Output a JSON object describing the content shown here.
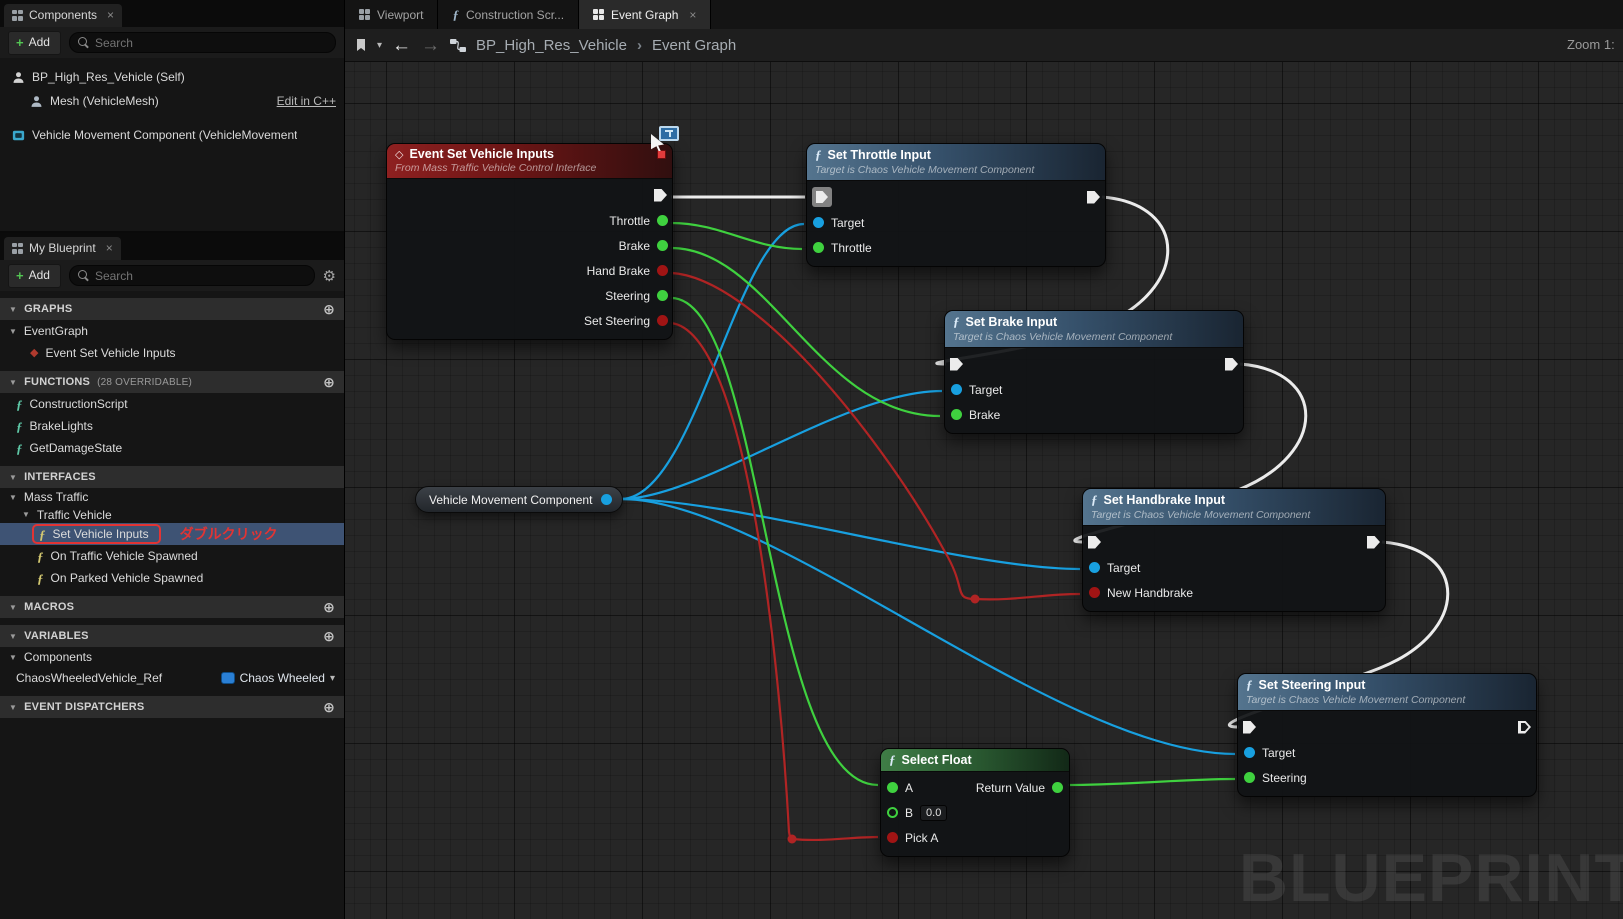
{
  "components_panel": {
    "tab_label": "Components",
    "add_label": "Add",
    "search_placeholder": "Search",
    "rows": [
      {
        "label": "BP_High_Res_Vehicle (Self)"
      },
      {
        "label": "Mesh (VehicleMesh)",
        "link_label": "Edit in C++"
      },
      {
        "label": "Vehicle Movement Component (VehicleMovement"
      }
    ]
  },
  "my_blueprint_panel": {
    "tab_label": "My Blueprint",
    "add_label": "Add",
    "search_placeholder": "Search",
    "graphs": {
      "header": "GRAPHS",
      "eventgraph_label": "EventGraph",
      "event_label": "Event Set Vehicle Inputs"
    },
    "functions": {
      "header": "FUNCTIONS",
      "badge": "(28 OVERRIDABLE)",
      "items": [
        "ConstructionScript",
        "BrakeLights",
        "GetDamageState"
      ]
    },
    "interfaces": {
      "header": "INTERFACES",
      "group": "Mass Traffic",
      "subgroup": "Traffic Vehicle",
      "items": [
        "Set Vehicle Inputs",
        "On Traffic Vehicle Spawned",
        "On Parked Vehicle Spawned"
      ]
    },
    "annotation_label": "ダブルクリック",
    "macros_header": "MACROS",
    "variables": {
      "header": "VARIABLES",
      "category": "Components",
      "var_name": "ChaosWheeledVehicle_Ref",
      "var_type": "Chaos Wheeled"
    },
    "event_dispatchers_header": "EVENT DISPATCHERS"
  },
  "editor_tabs": {
    "viewport": "Viewport",
    "construction": "Construction Scr...",
    "event_graph": "Event Graph"
  },
  "breadcrumb": {
    "root": "BP_High_Res_Vehicle",
    "current": "Event Graph"
  },
  "zoom_label": "Zoom 1:",
  "watermark": "BLUEPRINT",
  "graph": {
    "colors": {
      "exec": "#ececec",
      "float": "#3fd13f",
      "bool": "#a01414",
      "object": "#18a0e0"
    },
    "nodes": {
      "event": {
        "title": "Event Set Vehicle Inputs",
        "subtitle": "From Mass Traffic Vehicle Control Interface",
        "pins": {
          "throttle": "Throttle",
          "brake": "Brake",
          "hand_brake": "Hand Brake",
          "steering": "Steering",
          "set_steering": "Set Steering"
        }
      },
      "set_throttle": {
        "title": "Set Throttle Input",
        "subtitle": "Target is Chaos Vehicle Movement Component",
        "pins": {
          "target": "Target",
          "throttle": "Throttle"
        }
      },
      "set_brake": {
        "title": "Set Brake Input",
        "subtitle": "Target is Chaos Vehicle Movement Component",
        "pins": {
          "target": "Target",
          "brake": "Brake"
        }
      },
      "set_handbrake": {
        "title": "Set Handbrake Input",
        "subtitle": "Target is Chaos Vehicle Movement Component",
        "pins": {
          "target": "Target",
          "new_handbrake": "New Handbrake"
        }
      },
      "set_steering": {
        "title": "Set Steering Input",
        "subtitle": "Target is Chaos Vehicle Movement Component",
        "pins": {
          "target": "Target",
          "steering": "Steering"
        }
      },
      "vehicle_movement": {
        "title": "Vehicle Movement Component"
      },
      "select_float": {
        "title": "Select Float",
        "pins": {
          "a": "A",
          "b": "B",
          "b_value": "0.0",
          "pick_a": "Pick A",
          "return_value": "Return Value"
        }
      }
    },
    "connections": [
      {
        "from": "event.exec",
        "to": "set_throttle.exec_in",
        "type": "exec"
      },
      {
        "from": "set_throttle.exec_out",
        "to": "set_brake.exec_in",
        "type": "exec"
      },
      {
        "from": "set_brake.exec_out",
        "to": "set_handbrake.exec_in",
        "type": "exec"
      },
      {
        "from": "set_handbrake.exec_out",
        "to": "set_steering.exec_in",
        "type": "exec"
      },
      {
        "from": "vehicle_movement.out",
        "to": "set_throttle.target",
        "type": "object"
      },
      {
        "from": "vehicle_movement.out",
        "to": "set_brake.target",
        "type": "object"
      },
      {
        "from": "vehicle_movement.out",
        "to": "set_handbrake.target",
        "type": "object"
      },
      {
        "from": "vehicle_movement.out",
        "to": "set_steering.target",
        "type": "object"
      },
      {
        "from": "event.throttle",
        "to": "set_throttle.throttle",
        "type": "float"
      },
      {
        "from": "event.brake",
        "to": "set_brake.brake",
        "type": "float"
      },
      {
        "from": "event.steering",
        "to": "select_float.a",
        "type": "float"
      },
      {
        "from": "select_float.return_value",
        "to": "set_steering.steering",
        "type": "float"
      },
      {
        "from": "event.hand_brake",
        "to": "set_handbrake.new_handbrake",
        "type": "bool"
      },
      {
        "from": "event.set_steering",
        "to": "select_float.pick_a",
        "type": "bool"
      }
    ]
  }
}
